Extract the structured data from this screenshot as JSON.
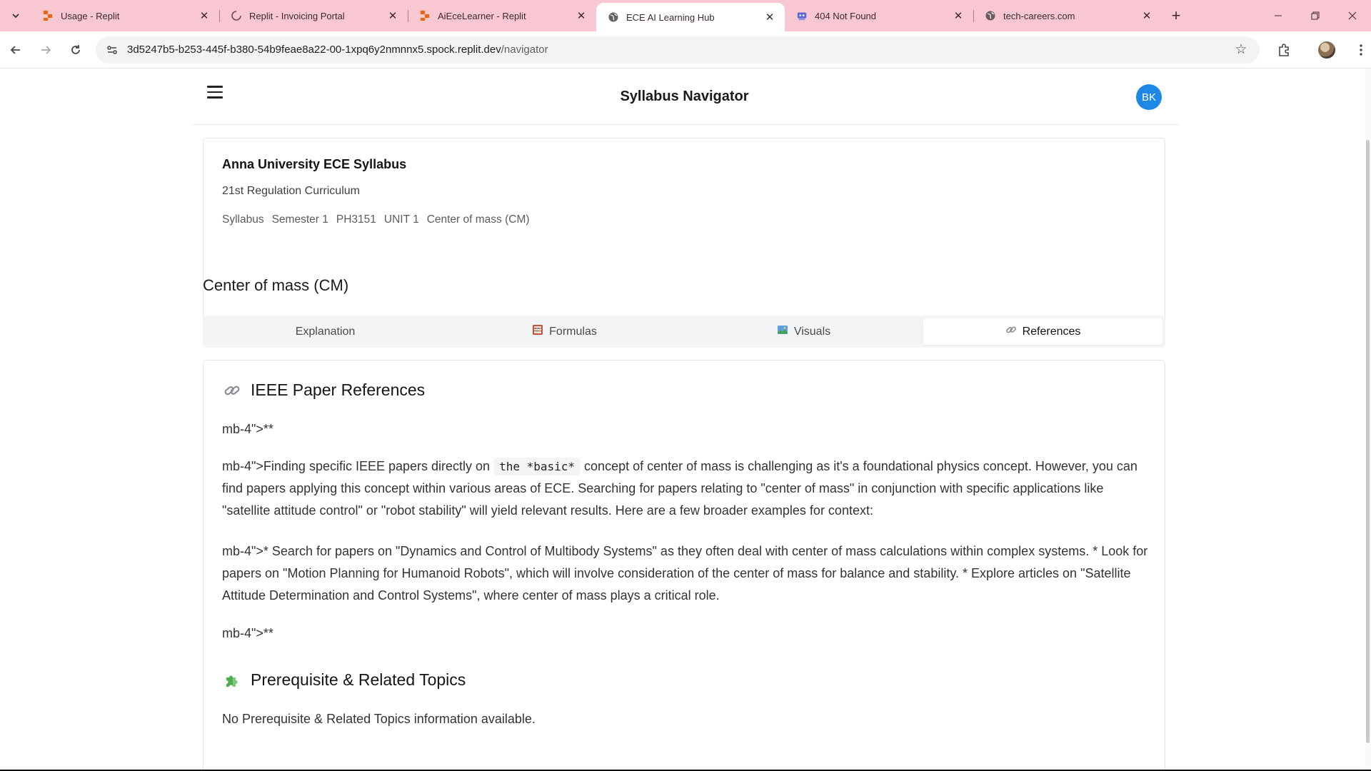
{
  "browser": {
    "tabs": [
      {
        "title": "Usage - Replit",
        "icon": "replit-icon",
        "active": false
      },
      {
        "title": "Replit - Invoicing Portal",
        "icon": "loading-spinner-icon",
        "active": false
      },
      {
        "title": "AiEceLearner - Replit",
        "icon": "replit-icon",
        "active": false
      },
      {
        "title": "ECE AI Learning Hub",
        "icon": "globe-icon",
        "active": true
      },
      {
        "title": "404 Not Found",
        "icon": "404-robot-icon",
        "active": false
      },
      {
        "title": "tech-careers.com",
        "icon": "globe-icon",
        "active": false
      }
    ],
    "url_host": "3d5247b5-b253-445f-b380-54b9feae8a22-00-1xpq6y2nmnnx5.spock.replit.dev",
    "url_path": "/navigator",
    "tab_bar_color": "#f8c7d2"
  },
  "header": {
    "title": "Syllabus Navigator",
    "avatar_initials": "BK",
    "avatar_color": "#1e88e5"
  },
  "course": {
    "name": "Anna University ECE Syllabus",
    "regulation": "21st Regulation Curriculum",
    "breadcrumb": [
      "Syllabus",
      "Semester 1",
      "PH3151",
      "UNIT 1",
      "Center of mass (CM)"
    ]
  },
  "topic": {
    "title": "Center of mass (CM)"
  },
  "tabs": [
    {
      "label": "Explanation",
      "icon": "",
      "active": false
    },
    {
      "label": "Formulas",
      "icon": "abacus-icon",
      "active": false
    },
    {
      "label": "Visuals",
      "icon": "picture-icon",
      "active": false
    },
    {
      "label": "References",
      "icon": "link-icon",
      "active": true
    }
  ],
  "references": {
    "heading": "IEEE Paper References",
    "p1": "mb-4\">**",
    "p2_before": "mb-4\">Finding specific IEEE papers directly on ",
    "p2_code": "the *basic*",
    "p2_after": " concept of center of mass is challenging as it's a foundational physics concept. However, you can find papers applying this concept within various areas of ECE. Searching for papers relating to \"center of mass\" in conjunction with specific applications like \"satellite attitude control\" or \"robot stability\" will yield relevant results. Here are a few broader examples for context:",
    "p3": "mb-4\">* Search for papers on \"Dynamics and Control of Multibody Systems\" as they often deal with center of mass calculations within complex systems. * Look for papers on \"Motion Planning for Humanoid Robots\", which will involve consideration of the center of mass for balance and stability. * Explore articles on \"Satellite Attitude Determination and Control Systems\", where center of mass plays a critical role.",
    "p4": "mb-4\">**"
  },
  "related": {
    "heading": "Prerequisite & Related Topics",
    "text": "No Prerequisite & Related Topics information available."
  }
}
